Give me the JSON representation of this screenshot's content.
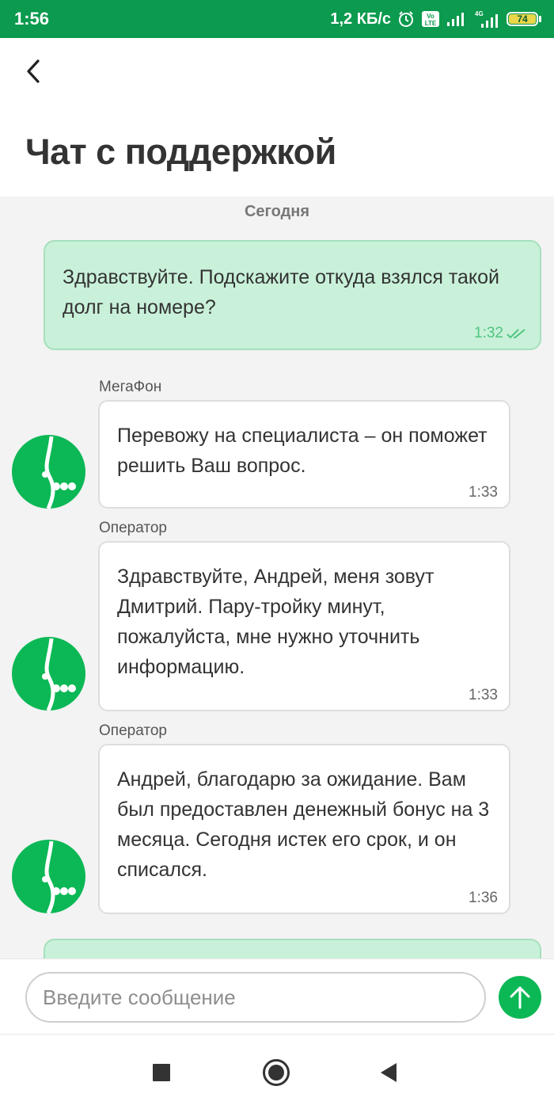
{
  "status_bar": {
    "time": "1:56",
    "net_speed": "1,2 КБ/с",
    "volte_label": "Vo LTE",
    "network_label": "4G",
    "battery": "74",
    "accent": "#0b9a4e"
  },
  "header": {
    "back_icon": "chevron-left-icon",
    "title": "Чат с поддержкой"
  },
  "chat": {
    "date_separator": "Сегодня",
    "messages": [
      {
        "direction": "outgoing",
        "text": "Здравствуйте. Подскажите откуда взялся такой долг на номере?",
        "time": "1:32",
        "status_icon": "double-check-icon"
      },
      {
        "direction": "incoming",
        "sender": "МегаФон",
        "text": "Перевожу на специалиста – он поможет решить Ваш вопрос.",
        "time": "1:33"
      },
      {
        "direction": "incoming",
        "sender": "Оператор",
        "text": "Здравствуйте, Андрей, меня зовут Дмитрий. Пару-тройку минут, пожалуйста, мне нужно уточнить информацию.",
        "time": "1:33"
      },
      {
        "direction": "incoming",
        "sender": "Оператор",
        "text": "Андрей, благодарю за ожидание. Вам был предоставлен денежный бонус на 3 месяца. Сегодня истек его срок, и он списался.",
        "time": "1:36"
      }
    ],
    "outgoing_bubble_color": "#c9f1d9",
    "brand_color": "#0bb855"
  },
  "composer": {
    "placeholder": "Введите сообщение",
    "value": "",
    "send_icon": "arrow-up-icon"
  },
  "nav": {
    "recents_icon": "square-icon",
    "home_icon": "circle-icon",
    "back_icon": "triangle-back-icon"
  }
}
